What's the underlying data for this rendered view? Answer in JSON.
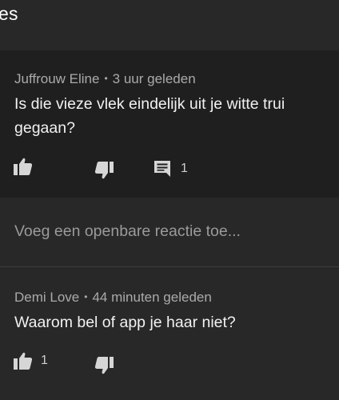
{
  "header": {
    "title": "es"
  },
  "comments": [
    {
      "author": "Juffrouw Eline",
      "separator": "•",
      "time": "3 uur geleden",
      "text": "Is die vieze vlek eindelijk uit je witte trui gegaan?",
      "like_count": "",
      "reply_count": "1"
    },
    {
      "author": "Demi Love",
      "separator": "•",
      "time": "44 minuten geleden",
      "text": "Waarom bel of app je haar niet?",
      "like_count": "1"
    }
  ],
  "reply_box": {
    "placeholder": "Voeg een openbare reactie toe..."
  },
  "icons": {
    "like": "thumbs-up-icon",
    "dislike": "thumbs-down-icon",
    "replies": "comment-icon"
  },
  "colors": {
    "background": "#282828",
    "highlight": "#1f1f1f",
    "meta": "#aaaaaa",
    "text": "#f1f1f1"
  }
}
